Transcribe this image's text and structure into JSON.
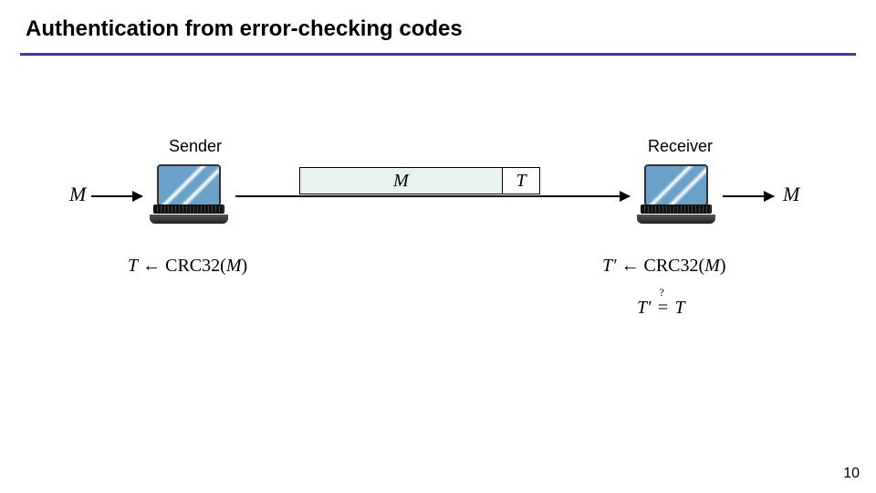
{
  "title": "Authentication from error-checking codes",
  "sender_label": "Sender",
  "receiver_label": "Receiver",
  "sym_M_left": "M",
  "sym_M_right": "M",
  "packet": {
    "m": "M",
    "t": "T"
  },
  "formula_sender": {
    "lhs": "T",
    "arrow": " ← ",
    "fn": "CRC32",
    "arg": "M"
  },
  "formula_receiver": {
    "lhs": "T′",
    "arrow": " ← ",
    "fn": "CRC32",
    "arg": "M"
  },
  "formula_check": {
    "lhs": "T′",
    "eq": "=",
    "q": "?",
    "rhs": "T"
  },
  "page_number": "10"
}
